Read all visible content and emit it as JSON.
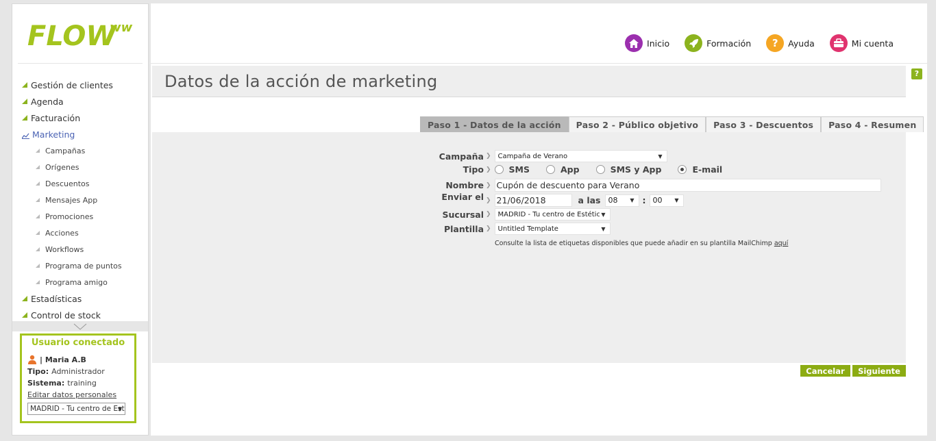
{
  "brand": {
    "logo_text": "FLOW",
    "logo_sup": "ww",
    "accent": "#8cb31e"
  },
  "sidebar": {
    "items": [
      {
        "label": "Gestión de clientes",
        "level": "top"
      },
      {
        "label": "Agenda",
        "level": "top"
      },
      {
        "label": "Facturación",
        "level": "top"
      },
      {
        "label": "Marketing",
        "level": "top",
        "active": true
      },
      {
        "label": "Campañas",
        "level": "sub"
      },
      {
        "label": "Orígenes",
        "level": "sub"
      },
      {
        "label": "Descuentos",
        "level": "sub"
      },
      {
        "label": "Mensajes App",
        "level": "sub"
      },
      {
        "label": "Promociones",
        "level": "sub"
      },
      {
        "label": "Acciones",
        "level": "sub"
      },
      {
        "label": "Workflows",
        "level": "sub"
      },
      {
        "label": "Programa de puntos",
        "level": "sub"
      },
      {
        "label": "Programa amigo",
        "level": "sub"
      },
      {
        "label": "Estadísticas",
        "level": "top"
      },
      {
        "label": "Control de stock",
        "level": "top"
      }
    ]
  },
  "user": {
    "title": "Usuario conectado",
    "name": "| Maria A.B",
    "tipo_label": "Tipo:",
    "tipo_value": "Administrador",
    "sistema_label": "Sistema:",
    "sistema_value": "training",
    "edit_link": "Editar datos personales",
    "branch": "MADRID - Tu centro de Estética"
  },
  "topnav": [
    {
      "label": "Inicio",
      "icon": "home-icon",
      "color": "#9b2fae"
    },
    {
      "label": "Formación",
      "icon": "rocket-icon",
      "color": "#8cb31e"
    },
    {
      "label": "Ayuda",
      "icon": "question-icon",
      "color": "#f5a623"
    },
    {
      "label": "Mi cuenta",
      "icon": "account-icon",
      "color": "#e0336e"
    }
  ],
  "page": {
    "title": "Datos de la acción de marketing",
    "help": "?"
  },
  "tabs": [
    {
      "label": "Paso 1 - Datos de la acción",
      "active": true
    },
    {
      "label": "Paso 2 - Público objetivo"
    },
    {
      "label": "Paso 3 - Descuentos"
    },
    {
      "label": "Paso 4 - Resumen"
    }
  ],
  "form": {
    "campana_label": "Campaña",
    "campana_value": "Campaña de Verano",
    "tipo_label": "Tipo",
    "tipo_options": [
      {
        "label": "SMS",
        "checked": false
      },
      {
        "label": "App",
        "checked": false
      },
      {
        "label": "SMS y App",
        "checked": false
      },
      {
        "label": "E-mail",
        "checked": true
      }
    ],
    "nombre_label": "Nombre",
    "nombre_value": "Cupón de descuento para Verano",
    "enviar_label": "Enviar el",
    "enviar_date": "21/06/2018",
    "alas_label": "a las",
    "hour": "08",
    "colon": ":",
    "minute": "00",
    "sucursal_label": "Sucursal",
    "sucursal_value": "MADRID - Tu centro de Estética",
    "plantilla_label": "Plantilla",
    "plantilla_value": "Untitled Template",
    "hint_text": "Consulte la lista de etiquetas disponibles que puede añadir en su plantilla MailChimp",
    "hint_link": "aquí"
  },
  "buttons": {
    "cancel": "Cancelar",
    "next": "Siguiente"
  }
}
